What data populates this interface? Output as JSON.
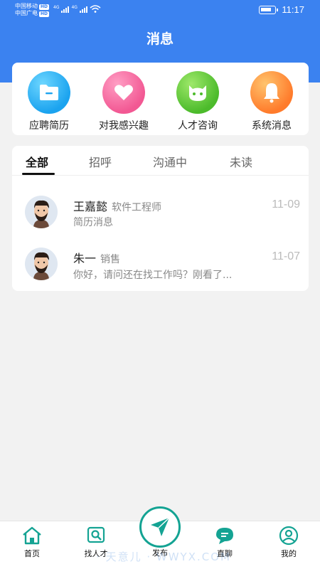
{
  "status_bar": {
    "carrier1": "中国移动",
    "carrier2": "中国广电",
    "hd": "HD",
    "net": "4G",
    "time": "11:17"
  },
  "header": {
    "title": "消息"
  },
  "quick_actions": [
    {
      "label": "应聘简历",
      "icon": "folder-icon"
    },
    {
      "label": "对我感兴趣",
      "icon": "heart-icon"
    },
    {
      "label": "人才咨询",
      "icon": "chat-face-icon"
    },
    {
      "label": "系统消息",
      "icon": "bell-icon"
    }
  ],
  "tabs": [
    {
      "label": "全部",
      "active": true
    },
    {
      "label": "招呼",
      "active": false
    },
    {
      "label": "沟通中",
      "active": false
    },
    {
      "label": "未读",
      "active": false
    }
  ],
  "messages": [
    {
      "name": "王嘉懿",
      "role": "软件工程师",
      "preview": "简历消息",
      "date": "11-09"
    },
    {
      "name": "朱一",
      "role": "销售",
      "preview": "你好，请问还在找工作吗？刚看了...",
      "date": "11-07"
    }
  ],
  "tabbar": [
    {
      "label": "首页",
      "icon": "home-icon"
    },
    {
      "label": "找人才",
      "icon": "find-talent-icon"
    },
    {
      "label": "发布",
      "icon": "publish-icon"
    },
    {
      "label": "直聊",
      "icon": "chat-icon"
    },
    {
      "label": "我的",
      "icon": "profile-icon"
    }
  ],
  "watermark": "· 天意儿 · WWYX.COM",
  "colors": {
    "primary": "#3b82f0",
    "accent": "#14a393"
  }
}
